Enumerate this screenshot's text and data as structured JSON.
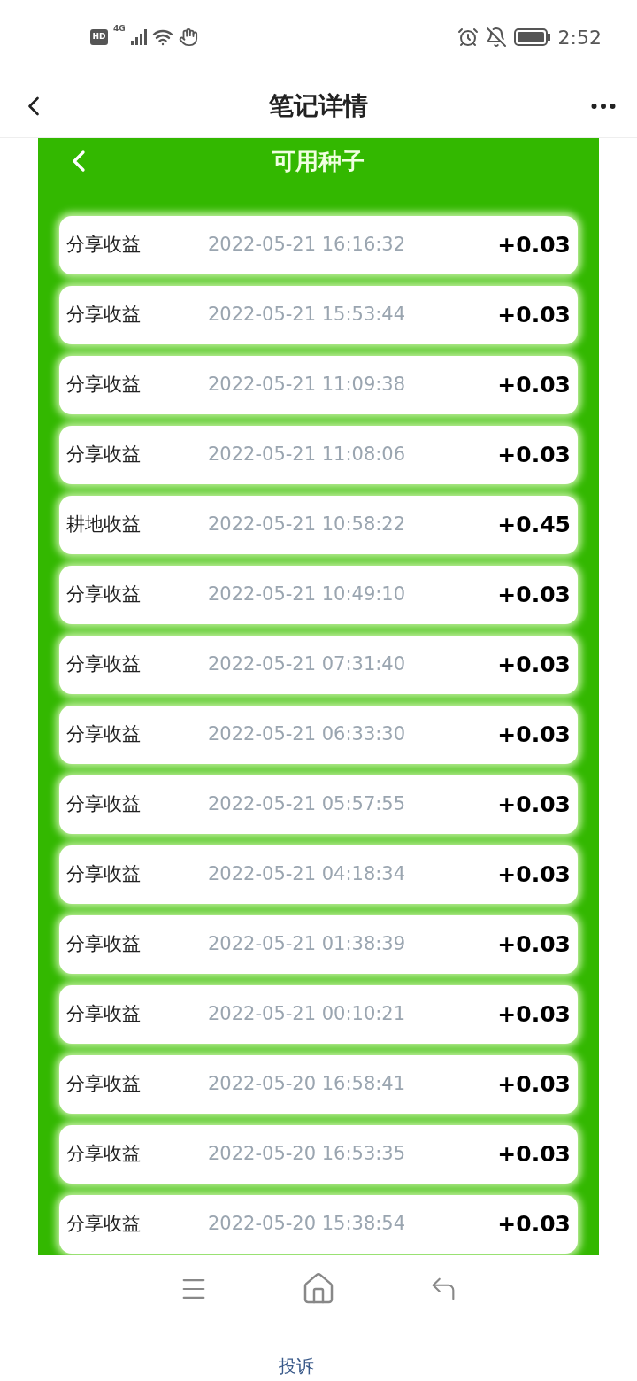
{
  "status_bar": {
    "hd": "HD",
    "time": "2:52",
    "network": "4G"
  },
  "header": {
    "title": "笔记详情"
  },
  "panel": {
    "title": "可用种子",
    "records": [
      {
        "label": "分享收益",
        "time": "2022-05-21 16:16:32",
        "amount": "+0.03"
      },
      {
        "label": "分享收益",
        "time": "2022-05-21 15:53:44",
        "amount": "+0.03"
      },
      {
        "label": "分享收益",
        "time": "2022-05-21 11:09:38",
        "amount": "+0.03"
      },
      {
        "label": "分享收益",
        "time": "2022-05-21 11:08:06",
        "amount": "+0.03"
      },
      {
        "label": "耕地收益",
        "time": "2022-05-21 10:58:22",
        "amount": "+0.45"
      },
      {
        "label": "分享收益",
        "time": "2022-05-21 10:49:10",
        "amount": "+0.03"
      },
      {
        "label": "分享收益",
        "time": "2022-05-21 07:31:40",
        "amount": "+0.03"
      },
      {
        "label": "分享收益",
        "time": "2022-05-21 06:33:30",
        "amount": "+0.03"
      },
      {
        "label": "分享收益",
        "time": "2022-05-21 05:57:55",
        "amount": "+0.03"
      },
      {
        "label": "分享收益",
        "time": "2022-05-21 04:18:34",
        "amount": "+0.03"
      },
      {
        "label": "分享收益",
        "time": "2022-05-21 01:38:39",
        "amount": "+0.03"
      },
      {
        "label": "分享收益",
        "time": "2022-05-21 00:10:21",
        "amount": "+0.03"
      },
      {
        "label": "分享收益",
        "time": "2022-05-20 16:58:41",
        "amount": "+0.03"
      },
      {
        "label": "分享收益",
        "time": "2022-05-20 16:53:35",
        "amount": "+0.03"
      },
      {
        "label": "分享收益",
        "time": "2022-05-20 15:38:54",
        "amount": "+0.03"
      }
    ]
  },
  "footer": {
    "link": "投诉"
  }
}
